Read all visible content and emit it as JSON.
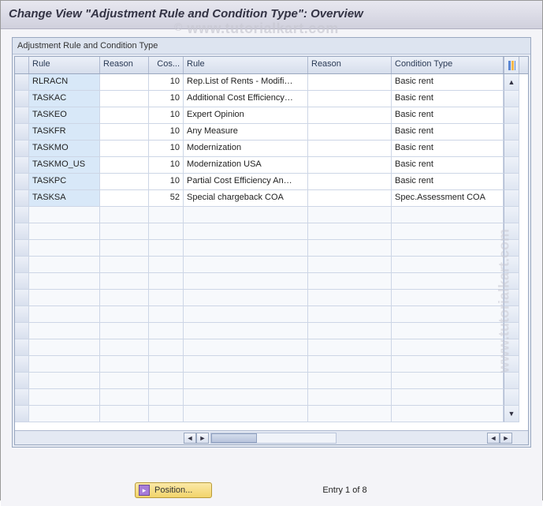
{
  "title": "Change View \"Adjustment Rule and Condition Type\": Overview",
  "watermark": "www.tutorialkart.com",
  "panel": {
    "title": "Adjustment Rule and Condition Type"
  },
  "columns": {
    "rule": "Rule",
    "reason": "Reason",
    "cos": "Cos...",
    "ruledesc": "Rule",
    "reason2": "Reason",
    "cond": "Condition Type"
  },
  "rows": [
    {
      "rule": "RLRACN",
      "reason": "",
      "cos": "10",
      "ruledesc": "Rep.List of Rents - Modifi…",
      "reason2": "",
      "cond": "Basic rent"
    },
    {
      "rule": "TASKAC",
      "reason": "",
      "cos": "10",
      "ruledesc": "Additional Cost Efficiency…",
      "reason2": "",
      "cond": "Basic rent"
    },
    {
      "rule": "TASKEO",
      "reason": "",
      "cos": "10",
      "ruledesc": "Expert Opinion",
      "reason2": "",
      "cond": "Basic rent"
    },
    {
      "rule": "TASKFR",
      "reason": "",
      "cos": "10",
      "ruledesc": "Any Measure",
      "reason2": "",
      "cond": "Basic rent"
    },
    {
      "rule": "TASKMO",
      "reason": "",
      "cos": "10",
      "ruledesc": "Modernization",
      "reason2": "",
      "cond": "Basic rent"
    },
    {
      "rule": "TASKMO_US",
      "reason": "",
      "cos": "10",
      "ruledesc": "Modernization USA",
      "reason2": "",
      "cond": "Basic rent"
    },
    {
      "rule": "TASKPC",
      "reason": "",
      "cos": "10",
      "ruledesc": "Partial Cost Efficiency An…",
      "reason2": "",
      "cond": "Basic rent"
    },
    {
      "rule": "TASKSA",
      "reason": "",
      "cos": "52",
      "ruledesc": "Special chargeback COA",
      "reason2": "",
      "cond": "Spec.Assessment COA"
    }
  ],
  "empty_row_count": 13,
  "footer": {
    "position_label": "Position...",
    "entry_text": "Entry 1 of 8"
  },
  "icons": {
    "scroll_up": "▲",
    "scroll_down": "▼",
    "scroll_left": "◄",
    "scroll_right": "►",
    "config": "⚙"
  }
}
